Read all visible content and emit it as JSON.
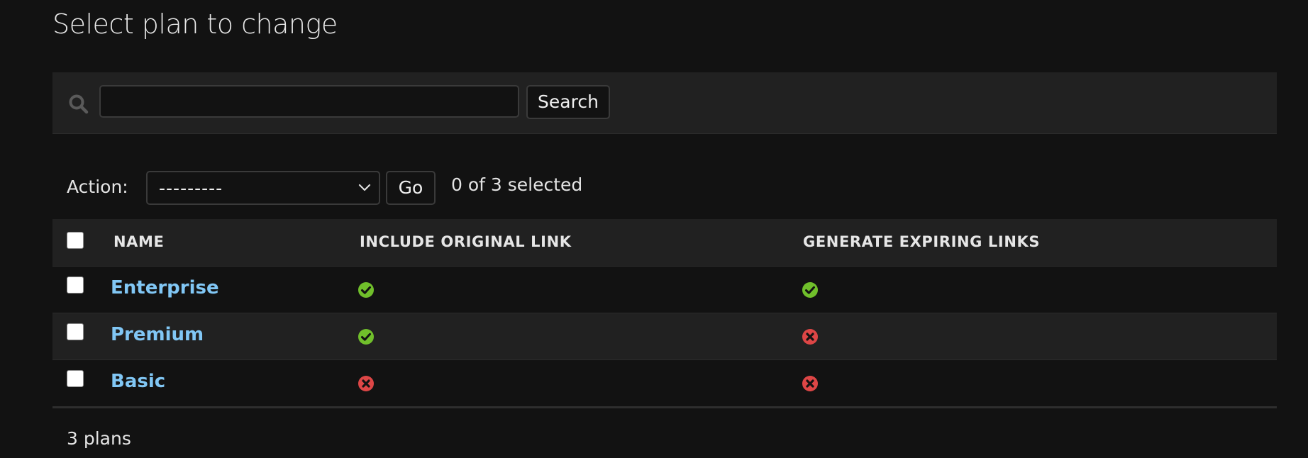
{
  "page": {
    "title": "Select plan to change"
  },
  "search": {
    "value": "",
    "placeholder": "",
    "button_label": "Search"
  },
  "actions": {
    "label": "Action:",
    "selected_option": "---------",
    "go_label": "Go",
    "selection_status": "0 of 3 selected"
  },
  "table": {
    "columns": [
      "Name",
      "Include original link",
      "Generate expiring links"
    ],
    "rows": [
      {
        "name": "Enterprise",
        "include_original_link": true,
        "generate_expiring_links": true
      },
      {
        "name": "Premium",
        "include_original_link": true,
        "generate_expiring_links": false
      },
      {
        "name": "Basic",
        "include_original_link": false,
        "generate_expiring_links": false
      }
    ]
  },
  "paginator": {
    "text": "3 plans"
  },
  "colors": {
    "background": "#121212",
    "panel": "#212121",
    "link": "#81c7f5",
    "yes_icon": "#70bf2b",
    "no_icon": "#dd4646"
  },
  "icons": {
    "yes": "check-circle-icon",
    "no": "x-circle-icon",
    "search": "search-icon"
  }
}
